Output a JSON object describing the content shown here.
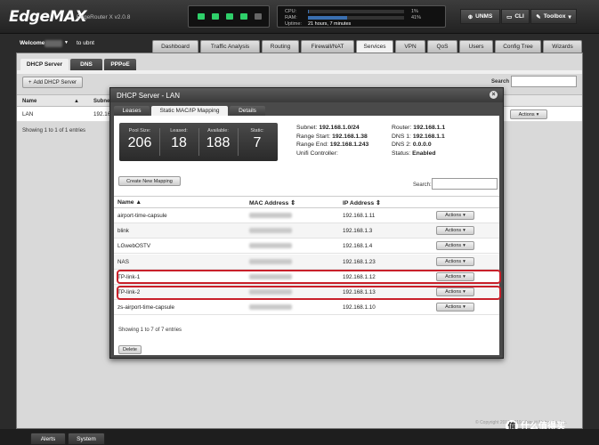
{
  "app": {
    "logo": "EdgeMAX",
    "version": "EdgeRouter X v2.0.8"
  },
  "stats": {
    "cpu_label": "CPU:",
    "cpu_value": "1%",
    "cpu_fraction": 0.01,
    "ram_label": "RAM:",
    "ram_value": "41%",
    "ram_fraction": 0.41,
    "uptime_label": "Uptime:",
    "uptime_value": "21 hours, 7 minutes"
  },
  "ports": {
    "count": 5,
    "active": [
      1,
      2,
      3,
      4
    ]
  },
  "top_buttons": {
    "unms": "UNMS",
    "cli": "CLI",
    "toolbox": "Toolbox"
  },
  "user": {
    "welcome": "Welcome",
    "to": "to ubnt"
  },
  "nav": {
    "dashboard": "Dashboard",
    "traffic": "Traffic Analysis",
    "routing": "Routing",
    "firewall": "Firewall/NAT",
    "services": "Services",
    "vpn": "VPN",
    "qos": "QoS",
    "users": "Users",
    "config": "Config Tree",
    "wizards": "Wizards"
  },
  "subtabs": {
    "dhcp": "DHCP Server",
    "dns": "DNS",
    "pppoe": "PPPoE"
  },
  "dhcp_page": {
    "add_button": "Add DHCP Server",
    "search_label": "Search",
    "col_name": "Name",
    "col_subnet": "Subnet",
    "row_name": "LAN",
    "row_subnet": "192.16",
    "actions": "Actions",
    "showing": "Showing 1 to 1 of 1 entries"
  },
  "modal": {
    "title": "DHCP Server - LAN",
    "tabs": {
      "leases": "Leases",
      "static": "Static MAC/IP Mapping",
      "details": "Details"
    },
    "pool": {
      "pool_size_label": "Pool Size:",
      "pool_size": "206",
      "leased_label": "Leased:",
      "leased": "18",
      "available_label": "Available:",
      "available": "188",
      "static_label": "Static:",
      "static": "7"
    },
    "info": {
      "subnet_label": "Subnet:",
      "subnet": "192.168.1.0/24",
      "range_start_label": "Range Start:",
      "range_start": "192.168.1.38",
      "range_end_label": "Range End:",
      "range_end": "192.168.1.243",
      "unifi_label": "Unifi Controller:",
      "router_label": "Router:",
      "router": "192.168.1.1",
      "dns1_label": "DNS 1:",
      "dns1": "192.168.1.1",
      "dns2_label": "DNS 2:",
      "dns2": "0.0.0.0",
      "status_label": "Status:",
      "status": "Enabled"
    },
    "new_mapping": "Create New Mapping",
    "search_label": "Search:",
    "columns": {
      "name": "Name ▲",
      "mac": "MAC Address ⇕",
      "ip": "IP Address ⇕"
    },
    "rows": [
      {
        "name": "airport-time-capsule",
        "ip": "192.168.1.11"
      },
      {
        "name": "blink",
        "ip": "192.168.1.3"
      },
      {
        "name": "LGwebOSTV",
        "ip": "192.168.1.4"
      },
      {
        "name": "NAS",
        "ip": "192.168.1.23"
      },
      {
        "name": "TP-link-1",
        "ip": "192.168.1.12"
      },
      {
        "name": "TP-link-2",
        "ip": "192.168.1.13"
      },
      {
        "name": "zs-airport-time-capsule",
        "ip": "192.168.1.10"
      }
    ],
    "actions": "Actions",
    "showing": "Showing 1 to 7 of 7 entries",
    "delete": "Delete"
  },
  "footer": {
    "copyright": "© Copyright 2012-2019 Ubiquiti Networks, Inc.",
    "watermark": "什么值得买"
  },
  "bottom_tabs": {
    "alerts": "Alerts",
    "system": "System"
  },
  "colors": {
    "highlight": "#c8202a",
    "port_active": "#2fd06a"
  }
}
